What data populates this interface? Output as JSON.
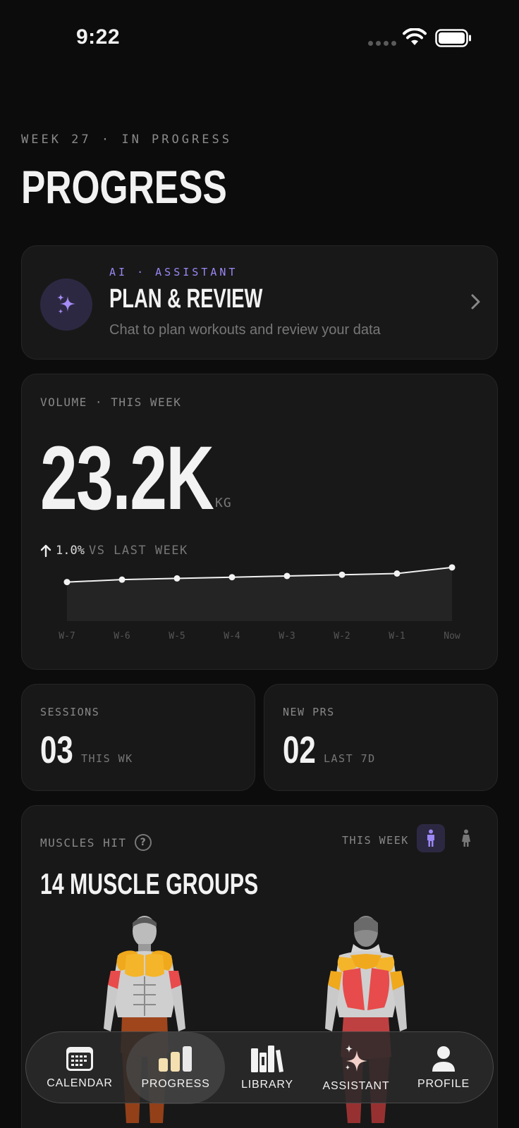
{
  "status_bar": {
    "time": "9:22"
  },
  "header": {
    "subtitle": "WEEK 27 · IN PROGRESS",
    "title": "PROGRESS"
  },
  "ai_card": {
    "eyebrow": "AI · ASSISTANT",
    "title": "PLAN & REVIEW",
    "description": "Chat to plan workouts and review your data",
    "icon": "sparkles-icon",
    "accent": "#9b87f5"
  },
  "volume": {
    "label": "VOLUME · THIS WEEK",
    "value": "23.2K",
    "unit": "KG",
    "delta": "1.0%",
    "delta_label": "VS LAST WEEK"
  },
  "chart_data": {
    "type": "area",
    "x": [
      "W-7",
      "W-6",
      "W-5",
      "W-4",
      "W-3",
      "W-2",
      "W-1",
      "Now"
    ],
    "values": [
      22.6,
      22.7,
      22.75,
      22.8,
      22.85,
      22.9,
      22.95,
      23.2
    ],
    "title": "",
    "xlabel": "",
    "ylabel": "",
    "grid": false
  },
  "stats": [
    {
      "label": "SESSIONS",
      "value": "03",
      "unit": "THIS WK"
    },
    {
      "label": "NEW PRS",
      "value": "02",
      "unit": "LAST 7D"
    }
  ],
  "muscles": {
    "label": "MUSCLES HIT",
    "period": "THIS WEEK",
    "title": "14 MUSCLE GROUPS",
    "help": "?"
  },
  "tabs": [
    {
      "label": "CALENDAR",
      "icon": "calendar-icon"
    },
    {
      "label": "PROGRESS",
      "icon": "bar-chart-icon",
      "active": true
    },
    {
      "label": "LIBRARY",
      "icon": "library-icon"
    },
    {
      "label": "ASSISTANT",
      "icon": "sparkles-icon"
    },
    {
      "label": "PROFILE",
      "icon": "person-icon"
    }
  ]
}
